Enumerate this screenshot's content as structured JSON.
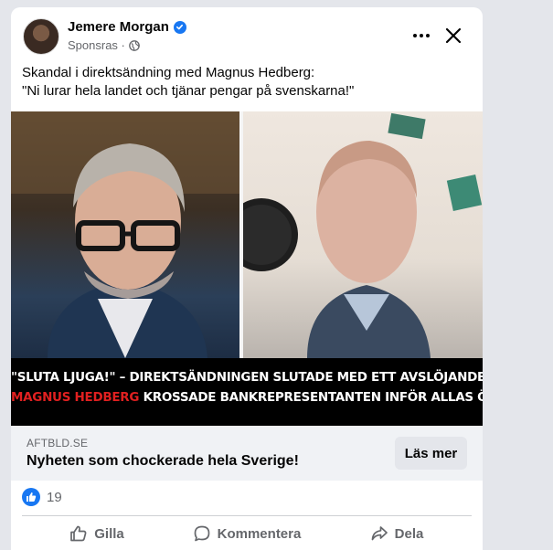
{
  "post": {
    "author": "Jemere Morgan",
    "sponsored_label": "Sponsras · ",
    "text_line1": "Skandal i direktsändning med Magnus Hedberg:",
    "text_line2": "\"Ni lurar hela landet och tjänar pengar på svenskarna!\""
  },
  "media": {
    "caption_line1": "\"SLUTA LJUGA!\" – DIREKTSÄNDNINGEN SLUTADE MED ETT AVSLÖJANDE.",
    "caption_line2_red": "MAGNUS HEDBERG",
    "caption_line2_rest": " KROSSADE BANKREPRESENTANTEN INFÖR ALLAS ÖGON."
  },
  "link": {
    "domain": "AFTBLD.SE",
    "title": "Nyheten som chockerade hela Sverige!",
    "cta_label": "Läs mer"
  },
  "reactions": {
    "count": "19"
  },
  "actions": {
    "like": "Gilla",
    "comment": "Kommentera",
    "share": "Dela"
  },
  "icons": {
    "verified": "verified-badge-icon",
    "privacy": "globe-icon",
    "more": "more-options-icon",
    "close": "close-icon",
    "like_badge": "thumbs-up-icon",
    "like_action": "thumbs-up-outline-icon",
    "comment_action": "speech-bubble-icon",
    "share_action": "share-arrow-icon"
  },
  "colors": {
    "accent": "#1877f2",
    "caption_red": "#e02020",
    "caption_bg": "#000000",
    "secondary_text": "#65676b"
  }
}
